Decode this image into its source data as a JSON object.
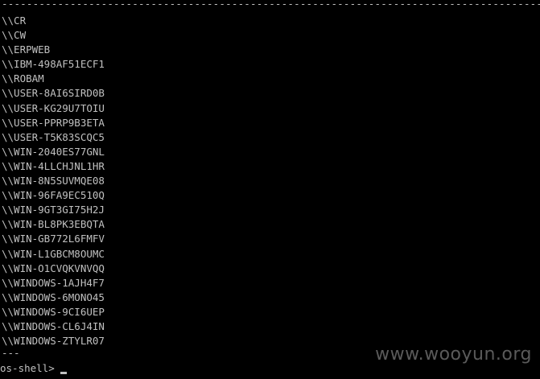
{
  "terminal": {
    "divider": "---------------------------------------------------------------------------------------------",
    "hosts": [
      "\\\\CR",
      "\\\\CW",
      "\\\\ERPWEB",
      "\\\\IBM-498AF51ECF1",
      "\\\\ROBAM",
      "\\\\USER-8AI6SIRD0B",
      "\\\\USER-KG29U7TOIU",
      "\\\\USER-PPRP9B3ETA",
      "\\\\USER-T5K83SCQC5",
      "\\\\WIN-2040ES77GNL",
      "\\\\WIN-4LLCHJNL1HR",
      "\\\\WIN-8N5SUVMQE08",
      "\\\\WIN-96FA9EC510Q",
      "\\\\WIN-9GT3GI75H2J",
      "\\\\WIN-BL8PK3EBQTA",
      "\\\\WIN-GB772L6FMFV",
      "\\\\WIN-L1GBCM8OUMC",
      "\\\\WIN-O1CVQKVNVQQ",
      "\\\\WINDOWS-1AJH4F7",
      "\\\\WINDOWS-6MONO45",
      "\\\\WINDOWS-9CI6UEP",
      "\\\\WINDOWS-CL6J4IN",
      "\\\\WINDOWS-ZTYLR07"
    ],
    "end_marker": "---",
    "prompt": "os-shell>",
    "watermark": "www.wooyun.org",
    "colors": {
      "background": "#000000",
      "foreground": "#c0c0c0",
      "watermark": "#5a5a5a"
    }
  }
}
